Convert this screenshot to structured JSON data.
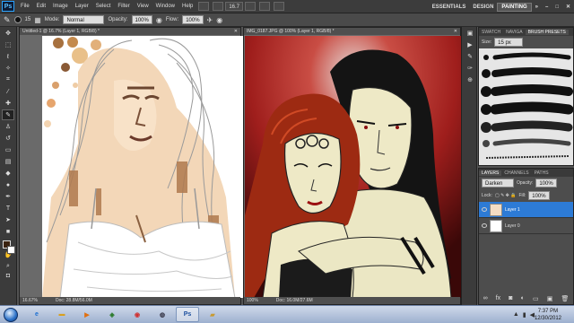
{
  "app": {
    "logo_text": "Ps"
  },
  "menu": {
    "items": [
      "File",
      "Edit",
      "Image",
      "Layer",
      "Select",
      "Filter",
      "View",
      "Window",
      "Help"
    ],
    "zoom": "16.7"
  },
  "workspaces": {
    "essentials": "ESSENTIALS",
    "design": "DESIGN",
    "painting": "PAINTING"
  },
  "options": {
    "mode_label": "Mode:",
    "mode_value": "Normal",
    "opacity_label": "Opacity:",
    "opacity_value": "100%",
    "flow_label": "Flow:",
    "flow_value": "100%",
    "brush_size": "15"
  },
  "doc_left": {
    "title": "Untitled-1 @ 16.7% (Layer 1, RGB/8) *",
    "zoom": "16.67%",
    "info": "Doc: 28.8M/56.0M"
  },
  "doc_right": {
    "title": "IMG_0187.JPG @ 100% (Layer 1, RGB/8) *",
    "zoom": "100%",
    "info": "Doc: 16.0M/27.6M"
  },
  "brushes_panel": {
    "tabs": [
      "SWATCH",
      "NAVIGA",
      "BRUSH PRESETS"
    ],
    "size_label": "Size:",
    "size_value": "15 px"
  },
  "layers_panel": {
    "tabs": [
      "LAYERS",
      "CHANNELS",
      "PATHS"
    ],
    "blend_mode": "Darken",
    "opacity_label": "Opacity:",
    "opacity_value": "100%",
    "lock_label": "Lock:",
    "fill_label": "Fill:",
    "fill_value": "100%",
    "layers": [
      {
        "name": "Layer 1",
        "active": true
      },
      {
        "name": "Layer 0",
        "active": false
      }
    ]
  },
  "taskbar": {
    "time": "7:37 PM",
    "date": "12/30/2012"
  },
  "colors": {
    "accent": "#2d7bd6",
    "background": "#535353",
    "skin": "#f3d7b8"
  }
}
